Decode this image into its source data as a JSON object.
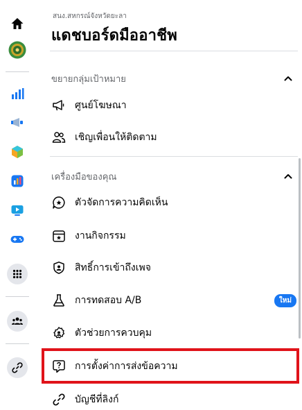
{
  "header": {
    "org_name": "สนง.สหกรณ์จังหวัดยะลา",
    "title": "แดชบอร์ดมืออาชีพ"
  },
  "sections": [
    {
      "label": "ขยายกลุ่มเป้าหมาย",
      "items": [
        {
          "label": "ศูนย์โฆษณา",
          "icon": "megaphone-icon"
        },
        {
          "label": "เชิญเพื่อนให้ติดตาม",
          "icon": "invite-friends-icon"
        }
      ]
    },
    {
      "label": "เครื่องมือของคุณ",
      "items": [
        {
          "label": "ตัวจัดการความคิดเห็น",
          "icon": "comment-manager-icon"
        },
        {
          "label": "งานกิจกรรม",
          "icon": "event-icon"
        },
        {
          "label": "สิทธิ์การเข้าถึงเพจ",
          "icon": "page-access-icon"
        },
        {
          "label": "การทดสอบ A/B",
          "icon": "flask-icon",
          "badge": "ใหม่"
        },
        {
          "label": "ตัวช่วยการควบคุม",
          "icon": "moderation-assist-icon"
        },
        {
          "label": "การตั้งค่าการส่งข้อความ",
          "icon": "messaging-settings-icon"
        },
        {
          "label": "บัญชีที่ลิงก์",
          "icon": "link-icon"
        }
      ]
    }
  ],
  "rail_icons": [
    "home-icon",
    "page-avatar-icon",
    "insights-icon",
    "ads-icon",
    "apps-icon",
    "planner-icon",
    "video-icon",
    "gaming-icon",
    "menu-icon",
    "groups-icon",
    "link-icon"
  ],
  "colors": {
    "accent": "#1877f2",
    "highlight": "#e0131a"
  }
}
